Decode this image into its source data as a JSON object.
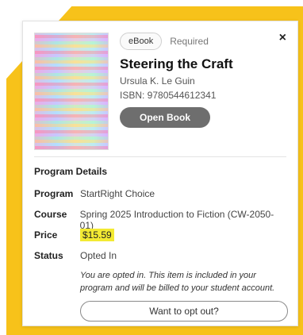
{
  "card": {
    "close_label": "×",
    "format_pill": "eBook",
    "required_label": "Required",
    "book_title": "Steering the Craft",
    "author": "Ursula K. Le Guin",
    "isbn": "ISBN: 9780544612341",
    "open_book_label": "Open Book",
    "section_title": "Program Details",
    "program_label": "Program",
    "program_value": "StartRight Choice",
    "course_label": "Course",
    "course_value": "Spring 2025 Introduction to Fiction (CW-2050-01)",
    "price_label": "Price",
    "price_value": "$15.59",
    "status_label": "Status",
    "status_value": "Opted In",
    "note": "You are opted in. This item is included in your program and will be billed to your student account.",
    "optout_label": "Want to opt out?"
  },
  "colors": {
    "brand_yellow": "#f7c21a",
    "status_green": "#1b8f45",
    "highlight": "#f3ea33"
  },
  "icons": {
    "close": "close-icon"
  }
}
